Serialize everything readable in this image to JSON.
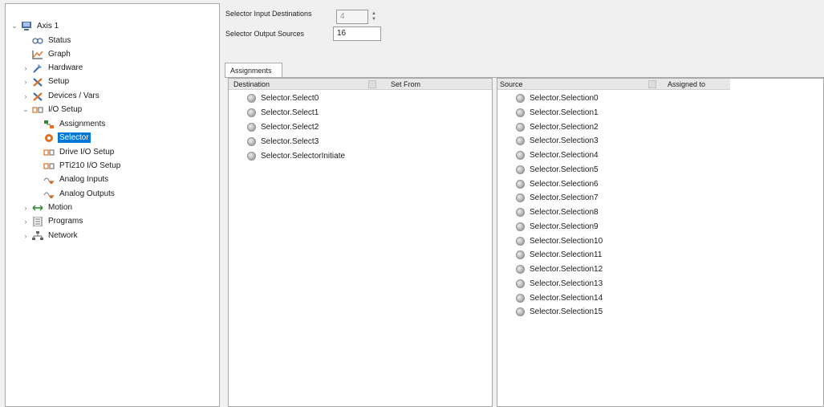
{
  "tree": {
    "items": [
      {
        "label": "Axis 1",
        "icon": "computer-icon",
        "chevron": "expanded"
      },
      {
        "label": "Status",
        "icon": "status-icon",
        "chevron": ""
      },
      {
        "label": "Graph",
        "icon": "graph-icon",
        "chevron": ""
      },
      {
        "label": "Hardware",
        "icon": "hardware-icon",
        "chevron": "collapsed"
      },
      {
        "label": "Setup",
        "icon": "setup-tools-icon",
        "chevron": "collapsed"
      },
      {
        "label": "Devices / Vars",
        "icon": "devices-tools-icon",
        "chevron": "collapsed"
      },
      {
        "label": "I/O Setup",
        "icon": "io-setup-icon",
        "chevron": "expanded"
      },
      {
        "label": "Assignments",
        "icon": "assignments-icon",
        "chevron": ""
      },
      {
        "label": "Selector",
        "icon": "selector-icon",
        "chevron": ""
      },
      {
        "label": "Drive I/O Setup",
        "icon": "drive-io-icon",
        "chevron": ""
      },
      {
        "label": "PTi210 I/O Setup",
        "icon": "pti210-io-icon",
        "chevron": ""
      },
      {
        "label": "Analog Inputs",
        "icon": "analog-inputs-icon",
        "chevron": ""
      },
      {
        "label": "Analog Outputs",
        "icon": "analog-outputs-icon",
        "chevron": ""
      },
      {
        "label": "Motion",
        "icon": "motion-arrows-icon",
        "chevron": "collapsed"
      },
      {
        "label": "Programs",
        "icon": "programs-icon",
        "chevron": "collapsed"
      },
      {
        "label": "Network",
        "icon": "network-icon",
        "chevron": "collapsed"
      }
    ],
    "selected_index": 8
  },
  "fields": {
    "input_dest_label": "Selector Input Destinations",
    "input_dest_value": "4",
    "output_src_label": "Selector Output Sources",
    "output_src_value": "16"
  },
  "tab": {
    "label": "Assignments"
  },
  "destination_panel": {
    "col1": "Destination",
    "col2": "Set From",
    "items": [
      "Selector.Select0",
      "Selector.Select1",
      "Selector.Select2",
      "Selector.Select3",
      "Selector.SelectorInitiate"
    ]
  },
  "source_panel": {
    "col1": "Source",
    "col2": "Assigned to",
    "items": [
      "Selector.Selection0",
      "Selector.Selection1",
      "Selector.Selection2",
      "Selector.Selection3",
      "Selector.Selection4",
      "Selector.Selection5",
      "Selector.Selection6",
      "Selector.Selection7",
      "Selector.Selection8",
      "Selector.Selection9",
      "Selector.Selection10",
      "Selector.Selection11",
      "Selector.Selection12",
      "Selector.Selection13",
      "Selector.Selection14",
      "Selector.Selection15"
    ]
  },
  "colors": {
    "selection": "#0078d7",
    "accent_green": "#2e8b2e",
    "accent_orange": "#e07020"
  }
}
